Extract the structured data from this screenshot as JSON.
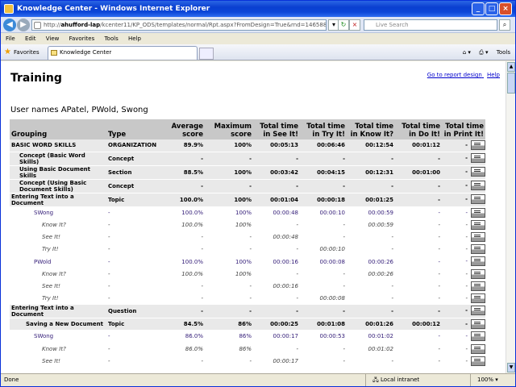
{
  "window": {
    "title": "Knowledge Center - Windows Internet Explorer"
  },
  "address": {
    "prefix": "http://",
    "host": "ahufford-lap",
    "rest": "/kcenter11/KP_ODS/templates/normal/Rpt.aspx?FromDesign=True&rnd=146588"
  },
  "search": {
    "placeholder": "Live Search"
  },
  "menu": [
    "File",
    "Edit",
    "View",
    "Favorites",
    "Tools",
    "Help"
  ],
  "favorites_label": "Favorites",
  "tab_title": "Knowledge Center",
  "tools_label": "Tools",
  "report": {
    "title": "Training",
    "link_design": "Go to report design",
    "link_help": "Help",
    "users": "User names APatel, PWold, Swong",
    "headers": [
      "Grouping",
      "Type",
      "Average score",
      "Maximum score",
      "Total time in See It!",
      "Total time in Try It!",
      "Total time in Know It?",
      "Total time in Do It!",
      "Total time in Print It!"
    ],
    "rows": [
      {
        "level": "lv0",
        "cells": [
          "BASIC WORD SKILLS",
          "ORGANIZATION",
          "89.9%",
          "100%",
          "00:05:13",
          "00:06:46",
          "00:12:54",
          "00:01:12",
          "-"
        ]
      },
      {
        "level": "lv1",
        "cells": [
          "Concept (Basic Word Skills)",
          "Concept",
          "-",
          "-",
          "-",
          "-",
          "-",
          "-",
          "-"
        ]
      },
      {
        "level": "lv1",
        "cells": [
          "Using Basic Document Skills",
          "Section",
          "88.5%",
          "100%",
          "00:03:42",
          "00:04:15",
          "00:12:31",
          "00:01:00",
          "-"
        ]
      },
      {
        "level": "lv2",
        "cells": [
          "Concept (Using Basic Document Skills)",
          "Concept",
          "-",
          "-",
          "-",
          "-",
          "-",
          "-",
          "-"
        ]
      },
      {
        "level": "lv3",
        "cells": [
          "Entering Text into a Document",
          "Topic",
          "100.0%",
          "100%",
          "00:01:04",
          "00:00:18",
          "00:01:25",
          "-",
          "-"
        ]
      },
      {
        "level": "user",
        "cells": [
          "SWong",
          "-",
          "100.0%",
          "100%",
          "00:00:48",
          "00:00:10",
          "00:00:59",
          "-",
          "-"
        ]
      },
      {
        "level": "mode",
        "cells": [
          "Know It?",
          "-",
          "100.0%",
          "100%",
          "-",
          "-",
          "00:00:59",
          "-",
          "-"
        ]
      },
      {
        "level": "mode",
        "cells": [
          "See It!",
          "-",
          "-",
          "-",
          "00:00:48",
          "-",
          "-",
          "-",
          "-"
        ]
      },
      {
        "level": "mode",
        "cells": [
          "Try It!",
          "-",
          "-",
          "-",
          "-",
          "00:00:10",
          "-",
          "-",
          "-"
        ]
      },
      {
        "level": "user",
        "cells": [
          "PWold",
          "-",
          "100.0%",
          "100%",
          "00:00:16",
          "00:00:08",
          "00:00:26",
          "-",
          "-"
        ]
      },
      {
        "level": "mode",
        "cells": [
          "Know It?",
          "-",
          "100.0%",
          "100%",
          "-",
          "-",
          "00:00:26",
          "-",
          "-"
        ]
      },
      {
        "level": "mode",
        "cells": [
          "See It!",
          "-",
          "-",
          "-",
          "00:00:16",
          "-",
          "-",
          "-",
          "-"
        ]
      },
      {
        "level": "mode",
        "cells": [
          "Try It!",
          "-",
          "-",
          "-",
          "-",
          "00:00:08",
          "-",
          "-",
          "-"
        ]
      },
      {
        "level": "lv3",
        "cells": [
          "Entering Text into a Document",
          "Question",
          "-",
          "-",
          "-",
          "-",
          "-",
          "-",
          "-"
        ]
      },
      {
        "level": "lv3 i1",
        "cells": [
          "Saving a New Document",
          "Topic",
          "84.5%",
          "86%",
          "00:00:25",
          "00:01:08",
          "00:01:26",
          "00:00:12",
          "-"
        ]
      },
      {
        "level": "user",
        "cells": [
          "SWong",
          "-",
          "86.0%",
          "86%",
          "00:00:17",
          "00:00:53",
          "00:01:02",
          "-",
          "-"
        ]
      },
      {
        "level": "mode",
        "cells": [
          "Know It?",
          "-",
          "86.0%",
          "86%",
          "-",
          "-",
          "00:01:02",
          "-",
          "-"
        ]
      },
      {
        "level": "mode",
        "cells": [
          "See It!",
          "-",
          "-",
          "-",
          "00:00:17",
          "-",
          "-",
          "-",
          "-"
        ]
      }
    ]
  },
  "status": {
    "text": "Done",
    "zone": "Local intranet",
    "zoom": "100%"
  }
}
